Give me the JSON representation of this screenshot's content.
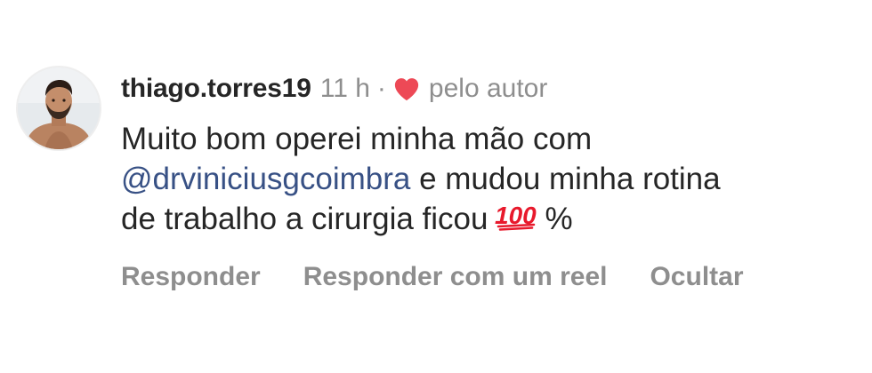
{
  "comment": {
    "username": "thiago.torres19",
    "time": "11 h",
    "separator": "·",
    "liked_by_author_label": "pelo autor",
    "text": {
      "line1": "Muito bom operei minha mão com",
      "mention": "@drviniciusgcoimbra",
      "line2_rest": " e mudou minha rotina",
      "line3_start": "de trabalho a cirurgia ficou",
      "emoji": "💯",
      "line3_end": "%"
    },
    "actions": {
      "reply": "Responder",
      "reply_with_reel": "Responder com um reel",
      "hide": "Ocultar"
    }
  },
  "colors": {
    "heart": "#ed4956",
    "mention": "#385185",
    "secondary_text": "#8e8e8e",
    "primary_text": "#262626"
  }
}
